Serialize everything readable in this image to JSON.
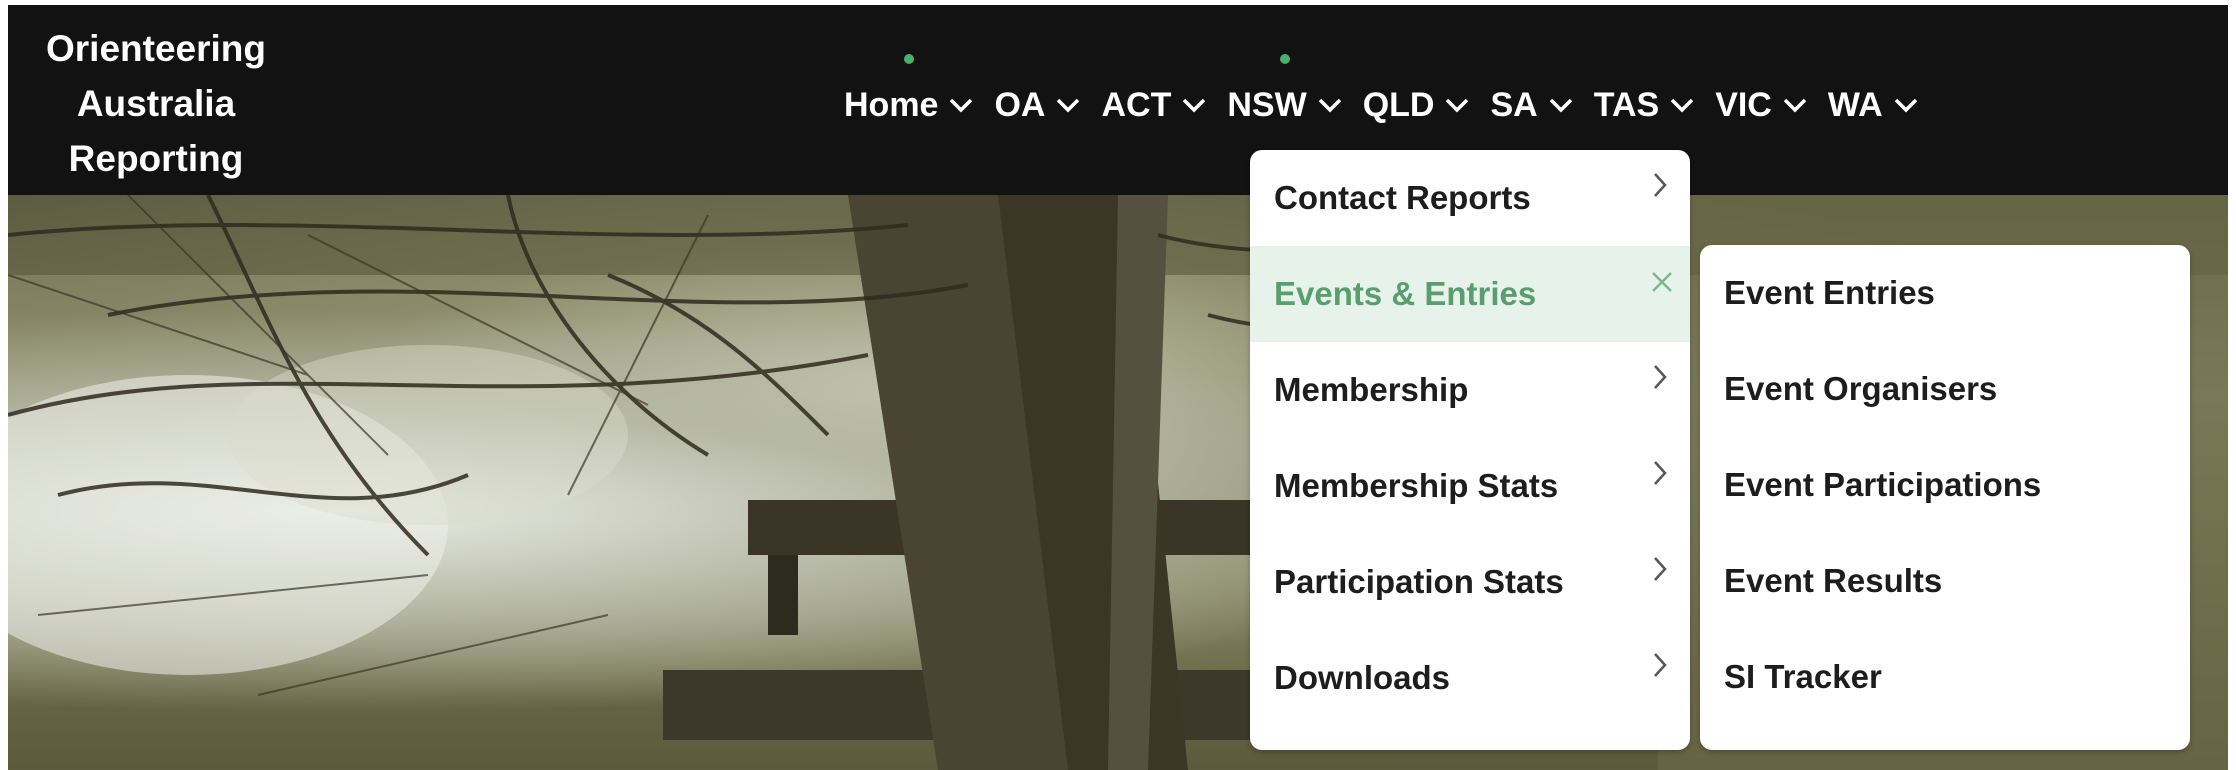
{
  "site": {
    "title_lines": [
      "Orienteering",
      "Australia",
      "Reporting"
    ]
  },
  "nav": {
    "items": [
      {
        "label": "Home",
        "has_dot": true
      },
      {
        "label": "OA",
        "has_dot": false
      },
      {
        "label": "ACT",
        "has_dot": false
      },
      {
        "label": "NSW",
        "has_dot": true
      },
      {
        "label": "QLD",
        "has_dot": false
      },
      {
        "label": "SA",
        "has_dot": false
      },
      {
        "label": "TAS",
        "has_dot": false
      },
      {
        "label": "VIC",
        "has_dot": false
      },
      {
        "label": "WA",
        "has_dot": false
      }
    ]
  },
  "dropdown": {
    "items": [
      {
        "label": "Contact Reports",
        "indicator": "chevron-right-icon"
      },
      {
        "label": "Events & Entries",
        "indicator": "close-icon",
        "active": true
      },
      {
        "label": "Membership",
        "indicator": "chevron-right-icon"
      },
      {
        "label": "Membership Stats",
        "indicator": "chevron-right-icon"
      },
      {
        "label": "Participation Stats",
        "indicator": "chevron-right-icon"
      },
      {
        "label": "Downloads",
        "indicator": "chevron-right-icon"
      }
    ]
  },
  "submenu": {
    "items": [
      {
        "label": "Event Entries"
      },
      {
        "label": "Event Organisers"
      },
      {
        "label": "Event Participations"
      },
      {
        "label": "Event Results"
      },
      {
        "label": "SI Tracker"
      }
    ]
  },
  "colors": {
    "header_bg": "#121212",
    "accent_green": "#4caf6a",
    "active_text": "#5a9e6f",
    "active_bg": "#e6f2ea"
  }
}
